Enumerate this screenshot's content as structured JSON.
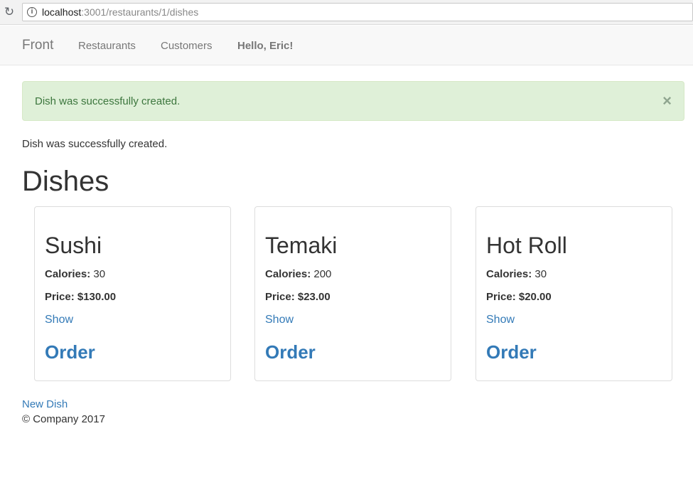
{
  "browser": {
    "url_host": "localhost",
    "url_path": ":3001/restaurants/1/dishes"
  },
  "navbar": {
    "brand": "Front",
    "links": [
      "Restaurants",
      "Customers"
    ],
    "greeting": "Hello, Eric!"
  },
  "alert": {
    "message": "Dish was successfully created.",
    "close": "×"
  },
  "notice": "Dish was successfully created.",
  "page_title": "Dishes",
  "dishes": [
    {
      "name": "Sushi",
      "calories_label": "Calories:",
      "calories": " 30",
      "price": "Price: $130.00",
      "show": "Show",
      "order": "Order"
    },
    {
      "name": "Temaki",
      "calories_label": "Calories:",
      "calories": " 200",
      "price": "Price: $23.00",
      "show": "Show",
      "order": "Order"
    },
    {
      "name": "Hot Roll",
      "calories_label": "Calories:",
      "calories": " 30",
      "price": "Price: $20.00",
      "show": "Show",
      "order": "Order"
    }
  ],
  "new_dish": "New Dish",
  "footer": "© Company 2017"
}
